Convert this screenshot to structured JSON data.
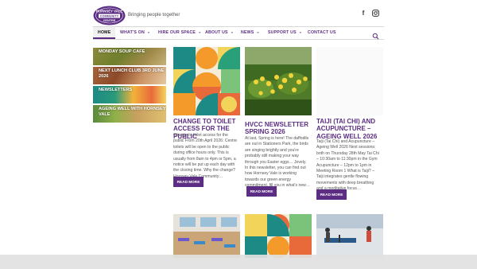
{
  "site": {
    "tagline": "Bringing people together",
    "logo_text": "HORNSEY VALE COMMUNITY CENTRE"
  },
  "social": {
    "facebook_icon": "facebook-icon",
    "instagram_icon": "instagram-icon"
  },
  "nav": {
    "items": [
      {
        "label": "HOME",
        "active": true
      },
      {
        "label": "WHAT'S ON",
        "dropdown": true
      },
      {
        "label": "HIRE OUR SPACE",
        "dropdown": true
      },
      {
        "label": "ABOUT US",
        "dropdown": true
      },
      {
        "label": "NEWS",
        "dropdown": true
      },
      {
        "label": "SUPPORT US",
        "dropdown": true
      },
      {
        "label": "CONTACT US"
      }
    ],
    "search_icon": "search-icon"
  },
  "sidebar": {
    "cards": [
      {
        "label": "MONDAY SOUP CAFE"
      },
      {
        "label": "NEXT LUNCH CLUB 3RD JUNE 2026"
      },
      {
        "label": "NEWSLETTERS"
      },
      {
        "label": "AGEING WELL WITH HORNSEY VALE"
      }
    ]
  },
  "posts": [
    {
      "title": "CHANGE TO TOILET ACCESS FOR THE PUBLIC",
      "excerpt": "Change to toilet access for the public From 20th April 2026: Centre toilets will be open to the public during office hours only. This is usually from 8am to 4pm or 5pm, a notice will be put up each day with the closing time. Why the change? Hornsey Vale Community…",
      "button": "READ MORE"
    },
    {
      "title": "HVCC NEWSLETTER SPRING 2026",
      "excerpt": "At last, Spring is here! The daffodils are out in Stationers Park, the birds are singing brightly and you're probably still making your way through you Easter eggs… Jovely. In this newsletter, you can find out how Hornsey Vale is working towards our green energy commitment, fill you in what's new…",
      "button": "READ MORE"
    },
    {
      "title": "TAIJI (TAI CHI) AND ACUPUNCTURE – AGEING WELL 2026",
      "excerpt": "Taiji (Tai Chi) and Acupuncture – Ageing Well 2026 Next sessions: both on Thursday 28th May Tai Chi – 10:30am to 11:30pm in the Gym Acupuncture – 12pm to 1pm in Meeting Room 1 What is Taiji? – Taiji integrates gentle flowing movements with deep breathing and a meditative focus…",
      "button": "READ MORE"
    }
  ],
  "colors": {
    "brand_purple": "#5b2d83",
    "accent_orange": "#f39a2b",
    "accent_teal": "#1e8a86"
  }
}
